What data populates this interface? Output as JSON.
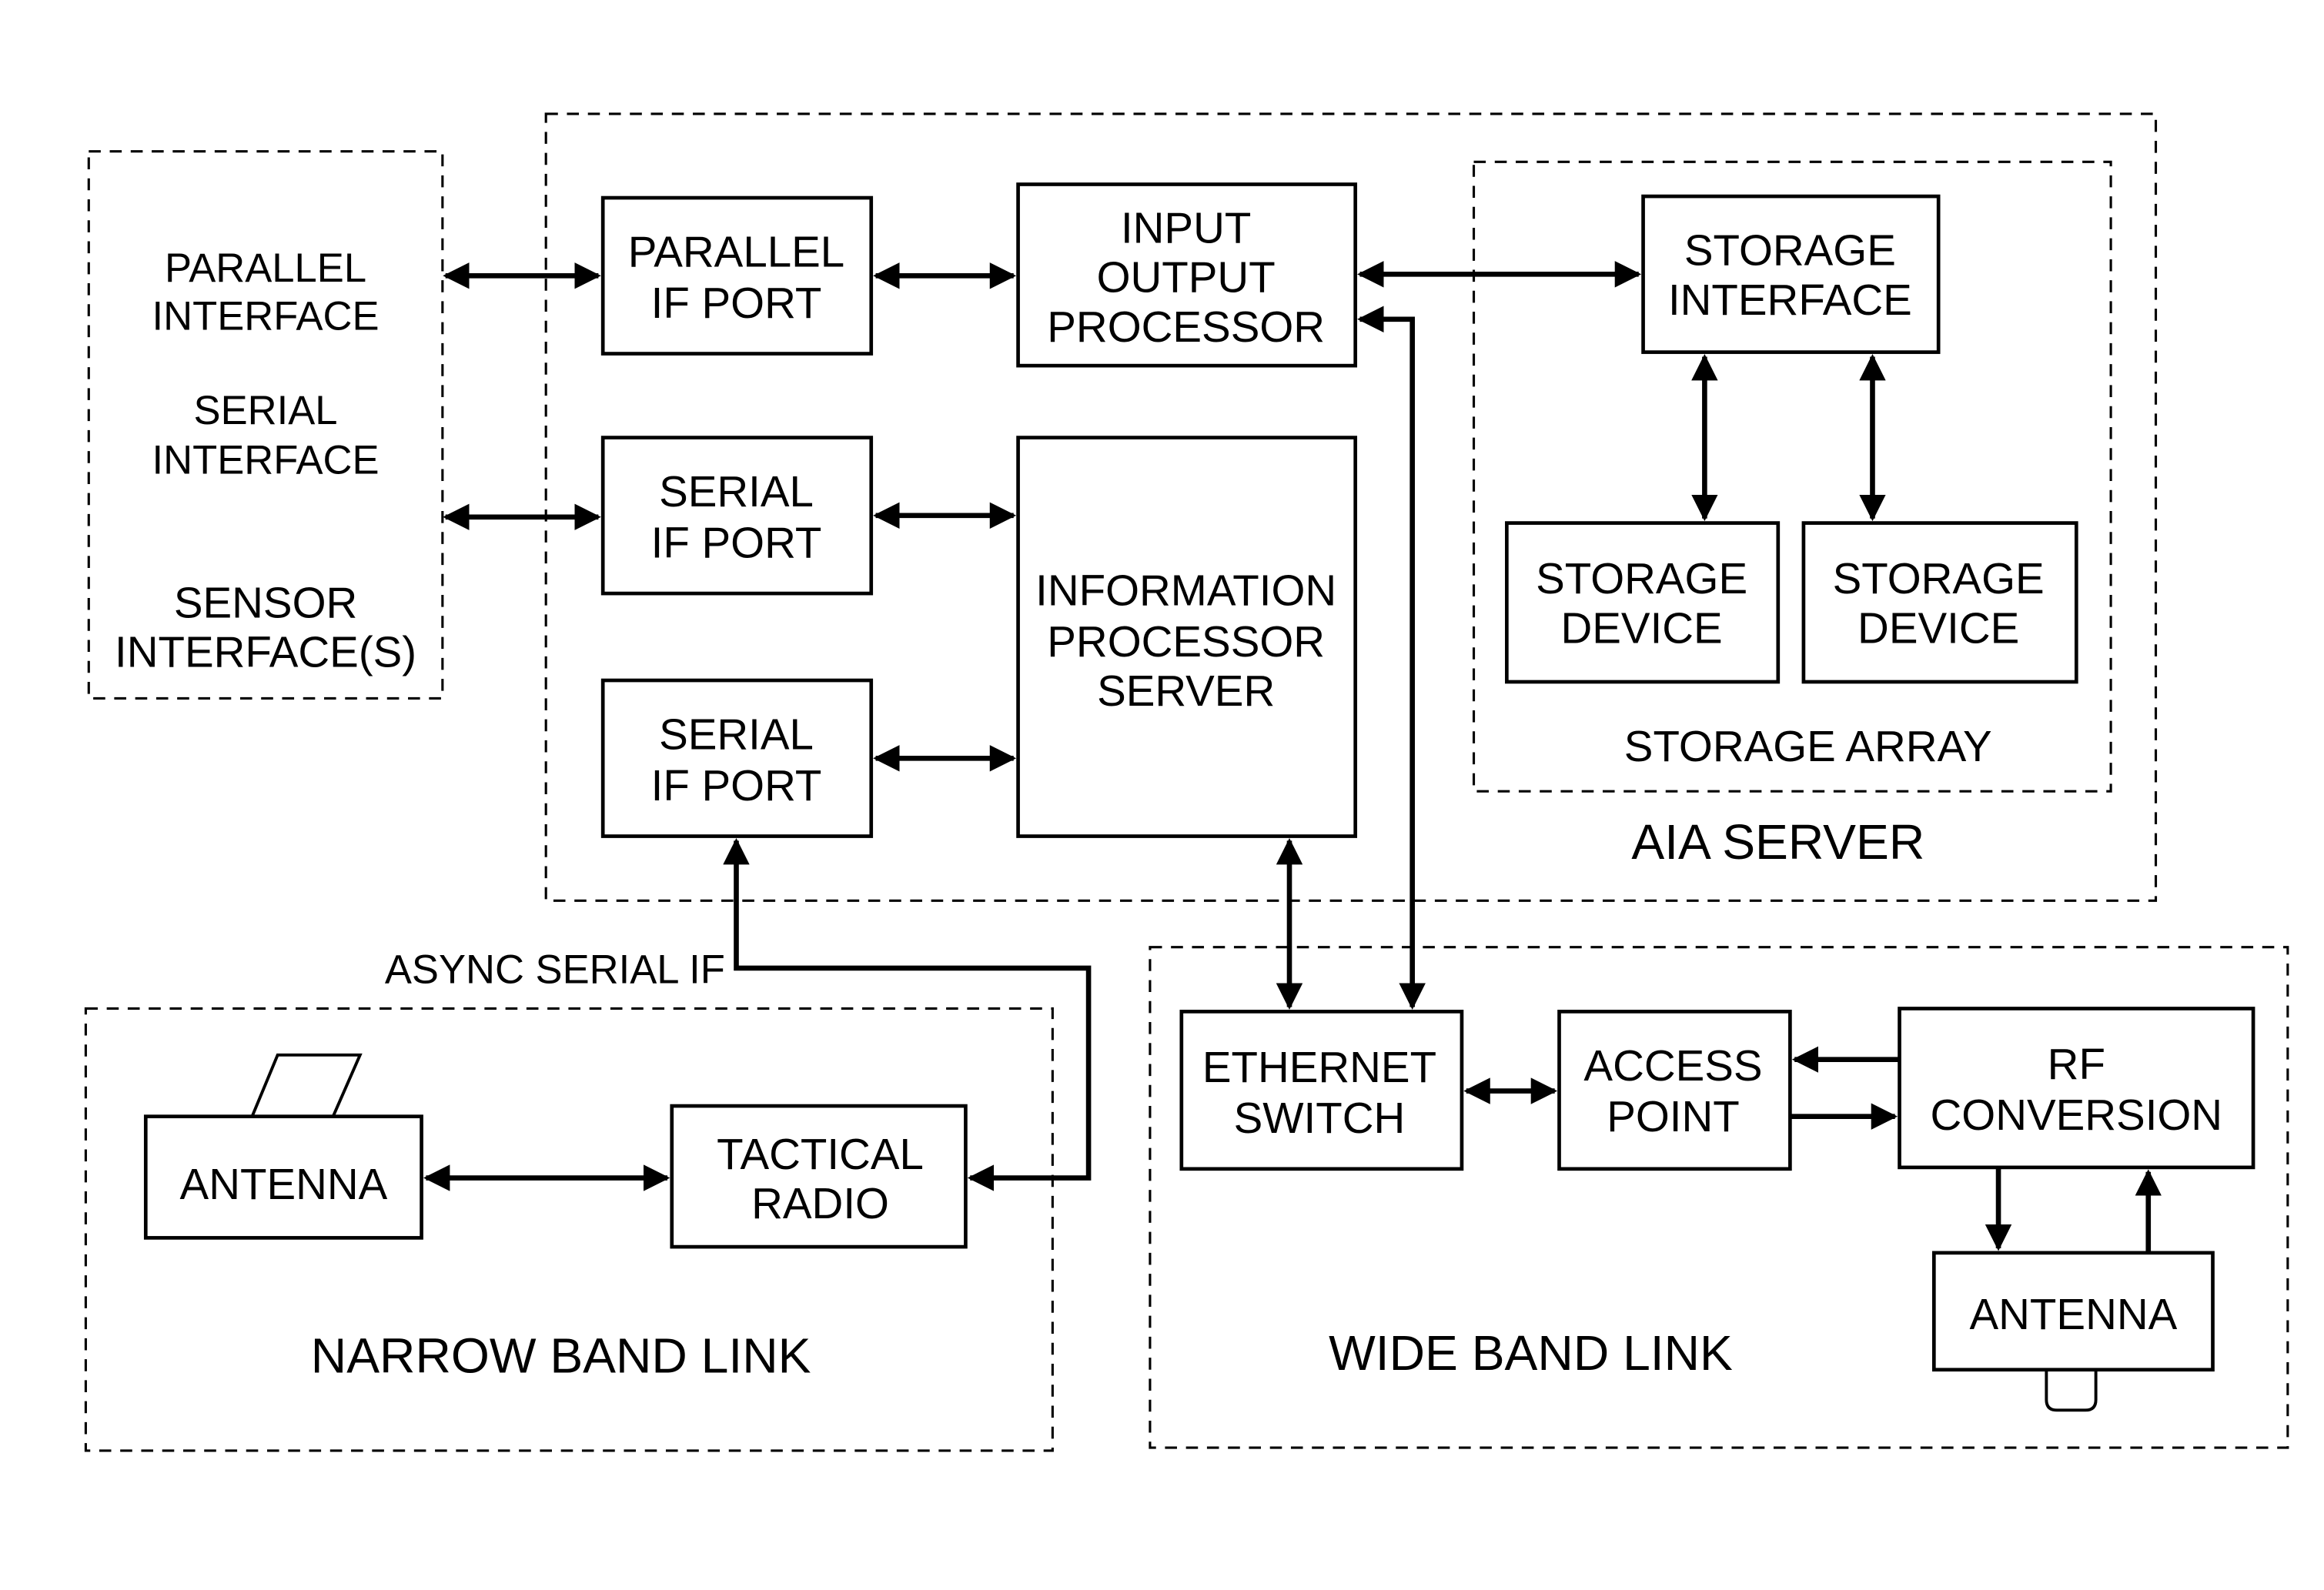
{
  "diagram": {
    "sensor_group": {
      "lines": [
        "PARALLEL",
        "INTERFACE",
        "SERIAL",
        "INTERFACE",
        "SENSOR",
        "INTERFACE(S)"
      ]
    },
    "aia_server": {
      "label": "AIA SERVER",
      "blocks": {
        "parallel_if_port": [
          "PARALLEL",
          "IF PORT"
        ],
        "serial_if_port_1": [
          "SERIAL",
          "IF PORT"
        ],
        "serial_if_port_2": [
          "SERIAL",
          "IF PORT"
        ],
        "input_output_processor": [
          "INPUT",
          "OUTPUT",
          "PROCESSOR"
        ],
        "information_processor_server": [
          "INFORMATION",
          "PROCESSOR",
          "SERVER"
        ]
      },
      "storage_array": {
        "label": "STORAGE ARRAY",
        "storage_interface": [
          "STORAGE",
          "INTERFACE"
        ],
        "storage_device_1": [
          "STORAGE",
          "DEVICE"
        ],
        "storage_device_2": [
          "STORAGE",
          "DEVICE"
        ]
      }
    },
    "async_label": "ASYNC SERIAL IF",
    "narrow_band_link": {
      "label": "NARROW BAND LINK",
      "antenna": "ANTENNA",
      "tactical_radio": [
        "TACTICAL",
        "RADIO"
      ]
    },
    "wide_band_link": {
      "label": "WIDE BAND LINK",
      "ethernet_switch": [
        "ETHERNET",
        "SWITCH"
      ],
      "access_point": [
        "ACCESS",
        "POINT"
      ],
      "rf_conversion": [
        "RF",
        "CONVERSION"
      ],
      "antenna": "ANTENNA"
    }
  }
}
